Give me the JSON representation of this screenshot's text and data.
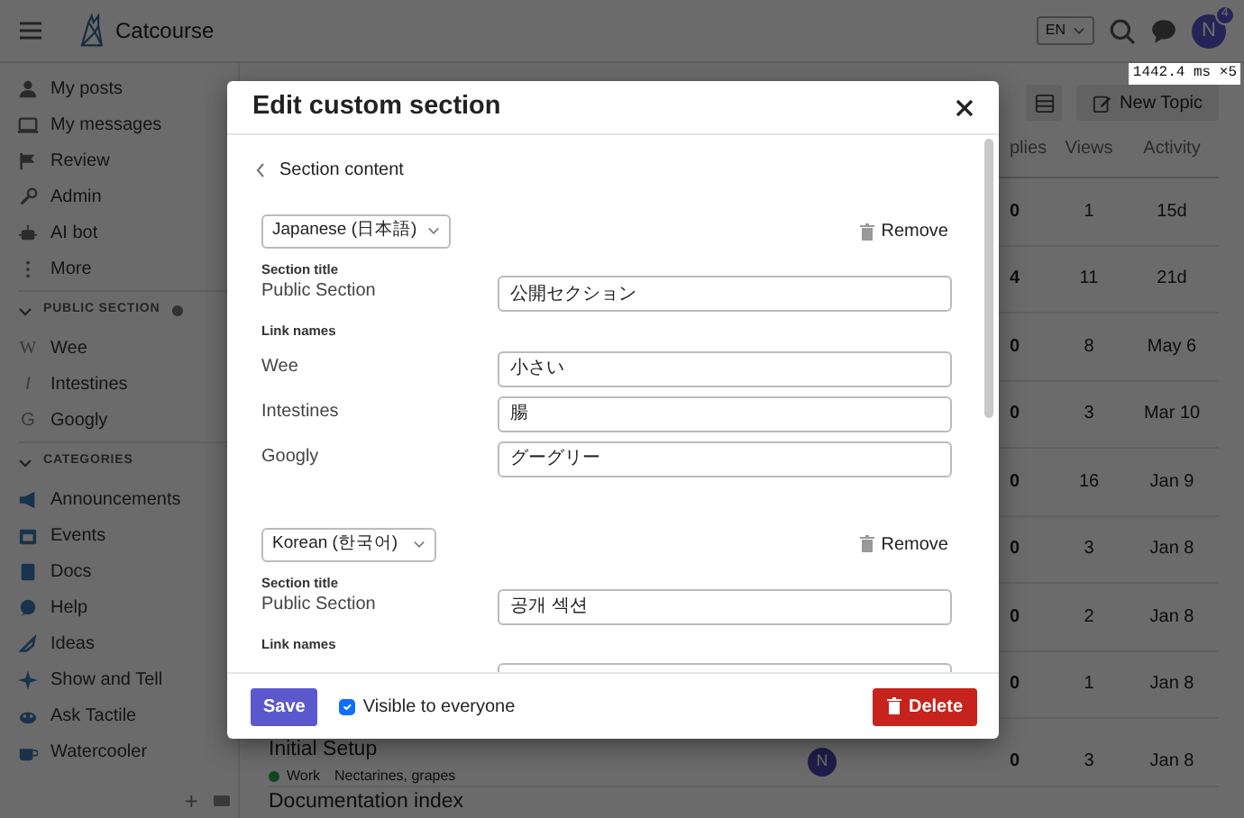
{
  "header": {
    "site_name": "Catcourse",
    "language": "EN",
    "user_initial": "N",
    "notification_count": "4"
  },
  "debug_timing": "1442.4 ms ×5",
  "sidebar": {
    "items": [
      {
        "label": "My posts"
      },
      {
        "label": "My messages"
      },
      {
        "label": "Review"
      },
      {
        "label": "Admin"
      },
      {
        "label": "AI bot"
      },
      {
        "label": "More"
      }
    ],
    "sections": [
      {
        "title": "PUBLIC SECTION",
        "expanded": true,
        "public": true,
        "links": [
          {
            "glyph": "W",
            "label": "Wee"
          },
          {
            "glyph": "I",
            "label": "Intestines"
          },
          {
            "glyph": "G",
            "label": "Googly"
          }
        ]
      },
      {
        "title": "CATEGORIES",
        "expanded": true,
        "public": false,
        "links": [
          {
            "label": "Announcements"
          },
          {
            "label": "Events"
          },
          {
            "label": "Docs"
          },
          {
            "label": "Help"
          },
          {
            "label": "Ideas"
          },
          {
            "label": "Show and Tell"
          },
          {
            "label": "Ask Tactile"
          },
          {
            "label": "Watercooler"
          }
        ]
      }
    ],
    "footer_add": "+"
  },
  "topic_list": {
    "new_topic": "New Topic",
    "columns": [
      "plies",
      "Views",
      "Activity"
    ],
    "rows": [
      {
        "replies": "0",
        "views": "1",
        "activity": "15d"
      },
      {
        "replies": "4",
        "views": "11",
        "activity": "21d"
      },
      {
        "replies": "0",
        "views": "8",
        "activity": "May 6"
      },
      {
        "replies": "0",
        "views": "3",
        "activity": "Mar 10"
      },
      {
        "replies": "0",
        "views": "16",
        "activity": "Jan 9"
      },
      {
        "replies": "0",
        "views": "3",
        "activity": "Jan 8"
      },
      {
        "replies": "0",
        "views": "2",
        "activity": "Jan 8"
      },
      {
        "replies": "0",
        "views": "1",
        "activity": "Jan 8"
      },
      {
        "title": "Initial Setup",
        "category": {
          "label": "Work",
          "color": "#12451f"
        },
        "tags": "Nectarines, grapes",
        "poster": "N",
        "replies": "0",
        "views": "3",
        "activity": "Jan 8"
      },
      {
        "title": "Documentation index"
      }
    ]
  },
  "modal": {
    "title": "Edit custom section",
    "back_label": "Section content",
    "locales": [
      {
        "language": "Japanese (日本語)",
        "remove": "Remove",
        "section_title_heading": "Section title",
        "title_label": "Public Section",
        "title_value": "公開セクション",
        "links_heading": "Link names",
        "links": [
          {
            "label": "Wee",
            "value": "小さい"
          },
          {
            "label": "Intestines",
            "value": "腸"
          },
          {
            "label": "Googly",
            "value": "グーグリー"
          }
        ],
        "more_below": false
      },
      {
        "language": "Korean (한국어)",
        "remove": "Remove",
        "section_title_heading": "Section title",
        "title_label": "Public Section",
        "title_value": "공개 섹션",
        "links_heading": "Link names",
        "more_below": true
      }
    ],
    "save": "Save",
    "visible": {
      "label": "Visible to everyone",
      "checked": true
    },
    "delete": "Delete"
  }
}
